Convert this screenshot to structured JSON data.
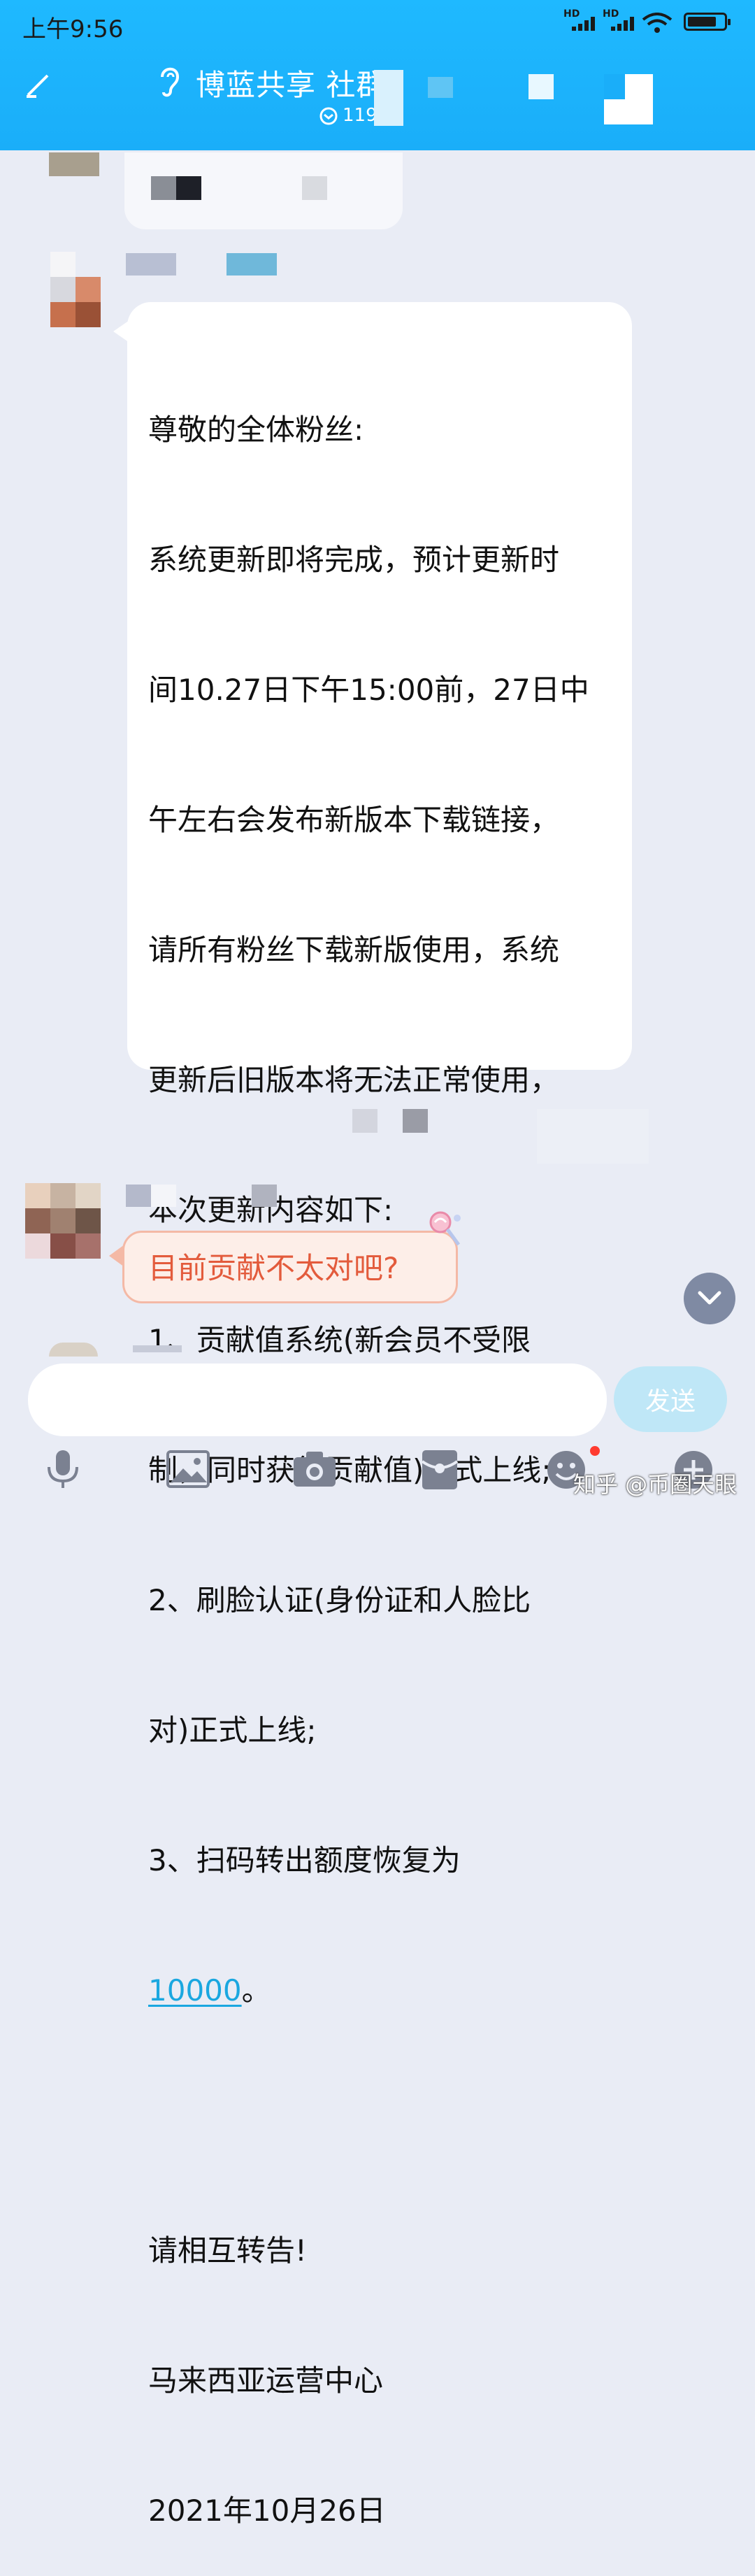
{
  "status_bar": {
    "time": "上午9:56",
    "hd1": "HD",
    "hd2": "HD"
  },
  "header": {
    "group_name": "博蓝共享 社群",
    "member_count": "119",
    "back_icon": "back-arrow-icon",
    "ear_icon": "ear-icon"
  },
  "message": {
    "lines": [
      "尊敬的全体粉丝:",
      "系统更新即将完成，预计更新时",
      "间10.27日下午15:00前，27日中",
      "午左右会发布新版本下载链接，",
      "请所有粉丝下载新版使用，系统",
      "更新后旧版本将无法正常使用，",
      "本次更新内容如下:",
      "1、贡献值系统(新会员不受限",
      "制，同时获得贡献值)正式上线;",
      "2、刷脸认证(身份证和人脸比",
      "对)正式上线;",
      "3、扫码转出额度恢复为"
    ],
    "link_value": "10000",
    "after_link": "。",
    "closing_lines": [
      "请相互转告!",
      "马来西亚运营中心",
      "2021年10月26日"
    ]
  },
  "reply": {
    "text": "目前贡献不太对吧?"
  },
  "input_bar": {
    "placeholder": "",
    "send_label": "发送"
  },
  "toolbar": {
    "icons": [
      "microphone-icon",
      "image-icon",
      "camera-icon",
      "red-packet-icon",
      "emoji-icon",
      "plus-icon"
    ]
  },
  "watermark": {
    "text": "知乎 @币圈天眼"
  },
  "colors": {
    "header": "#1aaef9",
    "background": "#e9ecf5",
    "link": "#1aa7e0",
    "reply_text": "#e35b3c",
    "send_button": "#bfe7f7"
  }
}
